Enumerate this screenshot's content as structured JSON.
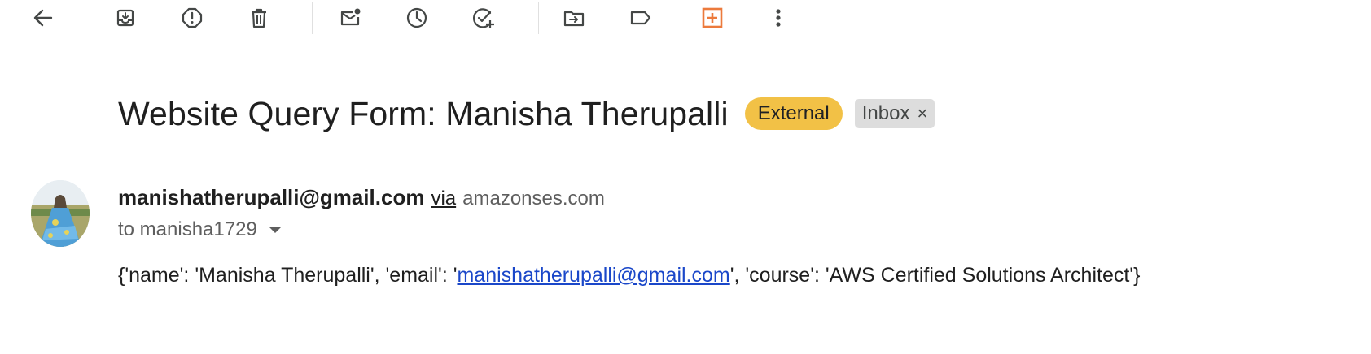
{
  "toolbar": {
    "icons": [
      "back-arrow-icon",
      "archive-icon",
      "report-spam-icon",
      "delete-icon",
      "mark-unread-icon",
      "snooze-icon",
      "add-to-tasks-icon",
      "move-to-icon",
      "label-icon",
      "addon-icon",
      "more-options-icon"
    ],
    "addon_color": "#ec7a3c",
    "icon_color": "#444746"
  },
  "email": {
    "subject": "Website Query Form: Manisha Therupalli",
    "labels": {
      "external": "External",
      "inbox": "Inbox",
      "inbox_remove": "×"
    },
    "sender": {
      "email": "manishatherupalli@gmail.com",
      "via": "via",
      "via_domain": "amazonses.com"
    },
    "to": "to manisha1729",
    "body": {
      "part1": "{'name': 'Manisha Therupalli', 'email': '",
      "link": "manishatherupalli@gmail.com",
      "part2": "', 'course': 'AWS Certified Solutions Architect'}"
    }
  },
  "colors": {
    "external_badge": "#f2c146",
    "inbox_badge": "#dddddd",
    "link": "#1a47c9"
  }
}
